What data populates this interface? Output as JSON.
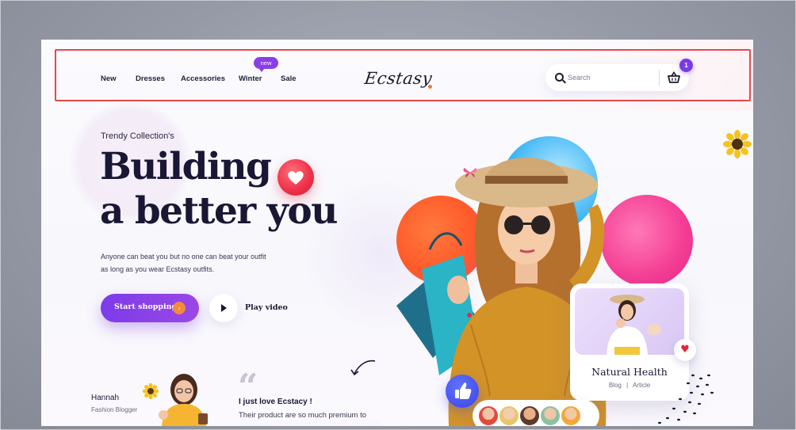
{
  "nav": {
    "links": [
      "New",
      "Dresses",
      "Accessories",
      "Winter",
      "Sale"
    ],
    "badge": "new",
    "logo": "Ecstasy",
    "search_placeholder": "Search",
    "cart_count": "1"
  },
  "hero": {
    "eyebrow": "Trendy Collection's",
    "headline_line1": "Building",
    "headline_line2": "a better you",
    "subtext": "Anyone can beat you but no one can beat your outfit as long as you wear Ecstasy outfits.",
    "primary_cta": "Start shopping",
    "secondary_cta": "Play video"
  },
  "testimonial": {
    "name": "Hannah",
    "role": "Fashion Blogger",
    "quote_title": "I just love Ecstacy !",
    "quote_body": "Their product are so much premium to"
  },
  "card": {
    "title": "Natural Health",
    "meta_left": "Blog",
    "meta_sep": "|",
    "meta_right": "Article"
  },
  "icons": {
    "search": "search-icon",
    "cart": "basket-icon",
    "arrow": "arrow-right-icon",
    "play": "play-icon",
    "heart": "heart-icon",
    "like": "thumbs-up-icon"
  },
  "colors": {
    "accent": "#7d3be8",
    "orange": "#f68a3c",
    "heading": "#1a1734",
    "highlight_box": "#e8474c"
  }
}
